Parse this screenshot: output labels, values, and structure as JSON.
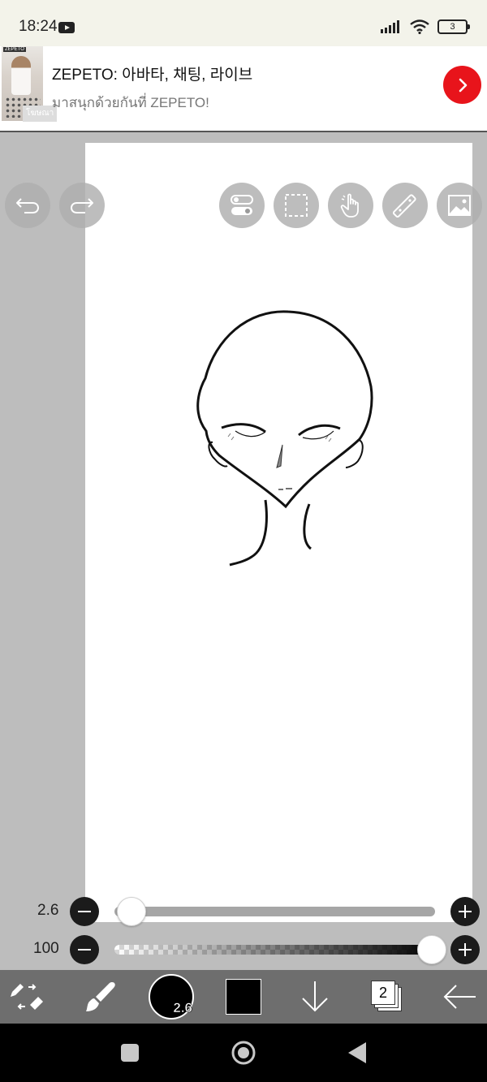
{
  "status_bar": {
    "time": "18:24",
    "battery_level": "3",
    "icons": [
      "youtube-icon",
      "signal-icon",
      "wifi-icon",
      "battery-icon"
    ]
  },
  "ad": {
    "title": "ZEPETO: 아바타, 채팅, 라이브",
    "subtitle": "มาสนุกด้วยกันที่ ZEPETO!",
    "thumb_logo": "ZEPETO",
    "thumb_caption": "โฆษณา",
    "accent_color": "#e8141b",
    "icons": [
      "chevron-right-icon"
    ]
  },
  "canvas": {
    "top_tools": [
      "undo-icon",
      "redo-icon",
      "toggle-icon",
      "selection-icon",
      "gesture-icon",
      "ruler-icon",
      "image-icon"
    ]
  },
  "sliders": {
    "brush_size": {
      "label": "2.6",
      "value": 2.6
    },
    "opacity": {
      "label": "100",
      "value": 100
    }
  },
  "toolbar": {
    "brush_size_badge": "2.6",
    "layer_count": "2",
    "current_color": "#000000",
    "icons": [
      "swap-tool-icon",
      "brush-icon",
      "color-icon",
      "download-arrow-icon",
      "layers-icon",
      "back-arrow-icon"
    ]
  },
  "nav": {
    "icons": [
      "recents-icon",
      "home-icon",
      "back-icon"
    ]
  }
}
